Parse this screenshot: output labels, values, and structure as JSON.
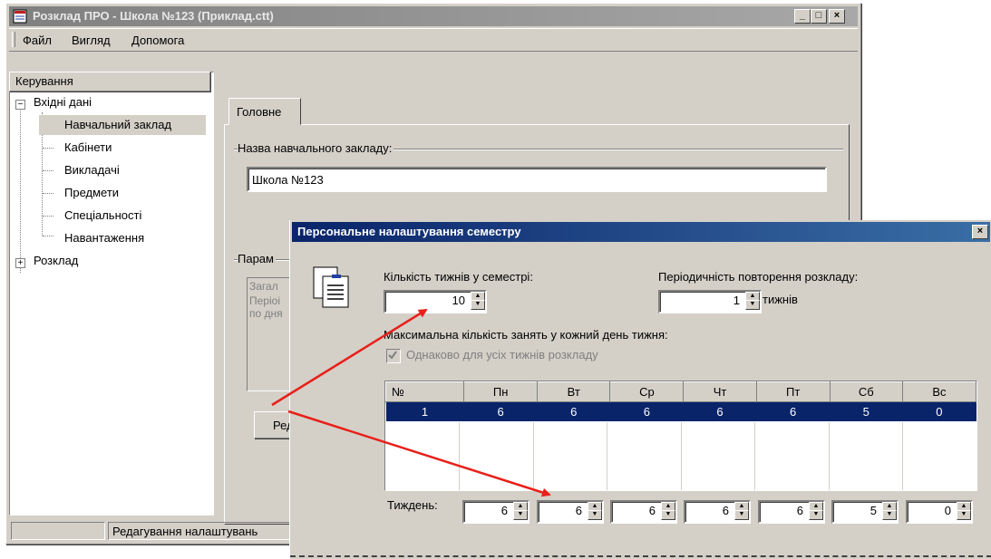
{
  "window": {
    "title": "Розклад ПРО - Школа №123 (Приклад.ctt)",
    "minimize": "_",
    "maximize": "□",
    "close": "×"
  },
  "menu": [
    "Файл",
    "Вигляд",
    "Допомога"
  ],
  "tree": {
    "header": "Керування",
    "root1": "Вхідні дані",
    "children": [
      "Навчальний заклад",
      "Кабінети",
      "Викладачі",
      "Предмети",
      "Спеціальності",
      "Навантаження"
    ],
    "root2": "Розклад",
    "expand_minus": "−",
    "expand_plus": "+"
  },
  "tab": {
    "label": "Головне",
    "institution_group": "Назва навчального закладу:",
    "institution_name": "Школа №123",
    "params_group": "Парам",
    "params_lines": [
      "Загал",
      "Періоі",
      "по дня"
    ],
    "edit_button": "Ред"
  },
  "status": {
    "cell1": "",
    "cell2": "Редагування налаштувань"
  },
  "dialog": {
    "title": "Персональне налаштування семестру",
    "close": "×",
    "weeks_label": "Кількість тижнів у семестрі:",
    "weeks_value": "10",
    "period_label": "Періодичність повторення розкладу:",
    "period_value": "1",
    "period_unit": "тижнів",
    "max_label": "Максимальна кількість занять у кожний день тижня:",
    "same_checkbox": "Однаково для усіх тижнів розкладу",
    "same_checked": true,
    "grid_headers": [
      "№",
      "Пн",
      "Вт",
      "Ср",
      "Чт",
      "Пт",
      "Сб",
      "Вс"
    ],
    "grid_rows": [
      [
        "1",
        "6",
        "6",
        "6",
        "6",
        "6",
        "5",
        "0"
      ]
    ],
    "week_label": "Тиждень:",
    "week_values": [
      "6",
      "6",
      "6",
      "6",
      "6",
      "5",
      "0"
    ],
    "spin_up": "▲",
    "spin_down": "▼"
  },
  "colors": {
    "face": "#d4d0c8",
    "selection": "#0a246a",
    "arrow": "#e8201a"
  }
}
